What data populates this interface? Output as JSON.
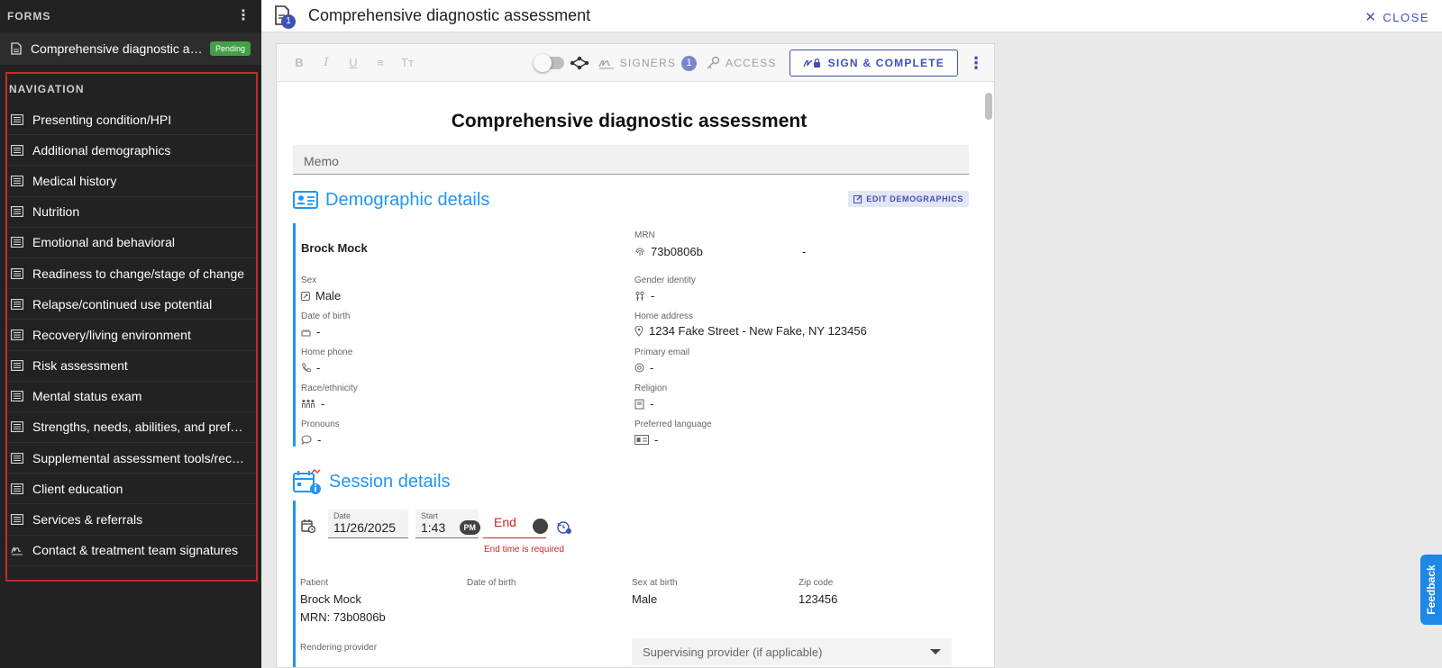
{
  "sidebar": {
    "forms_title": "FORMS",
    "form_item": {
      "label": "Comprehensive diagnostic assessment",
      "status": "Pending"
    },
    "nav_title": "NAVIGATION",
    "nav_items": [
      {
        "label": "Presenting condition/HPI",
        "icon": "list-icon"
      },
      {
        "label": "Additional demographics",
        "icon": "list-icon"
      },
      {
        "label": "Medical history",
        "icon": "list-icon"
      },
      {
        "label": "Nutrition",
        "icon": "list-icon"
      },
      {
        "label": "Emotional and behavioral",
        "icon": "list-icon"
      },
      {
        "label": "Readiness to change/stage of change",
        "icon": "list-icon"
      },
      {
        "label": "Relapse/continued use potential",
        "icon": "list-icon"
      },
      {
        "label": "Recovery/living environment",
        "icon": "list-icon"
      },
      {
        "label": "Risk assessment",
        "icon": "list-icon"
      },
      {
        "label": "Mental status exam",
        "icon": "list-icon"
      },
      {
        "label": "Strengths, needs, abilities, and preferences",
        "icon": "list-icon"
      },
      {
        "label": "Supplemental assessment tools/records",
        "icon": "list-icon"
      },
      {
        "label": "Client education",
        "icon": "list-icon"
      },
      {
        "label": "Services & referrals",
        "icon": "list-icon"
      },
      {
        "label": "Contact & treatment team signatures",
        "icon": "signature-icon"
      }
    ]
  },
  "topbar": {
    "title": "Comprehensive diagnostic assessment",
    "badge_count": "1",
    "close_label": "CLOSE"
  },
  "toolbar": {
    "bold": "B",
    "italic": "I",
    "underline": "U",
    "align": "≡",
    "clear_format": "Tт",
    "signers_label": "SIGNERS",
    "signers_count": "1",
    "access_label": "ACCESS",
    "sign_complete_label": "SIGN & COMPLETE"
  },
  "document": {
    "title": "Comprehensive diagnostic assessment",
    "memo_placeholder": "Memo",
    "demographics": {
      "section_title": "Demographic details",
      "edit_label": "EDIT DEMOGRAPHICS",
      "name": "Brock Mock",
      "mrn_label": "MRN",
      "mrn_value": "73b0806b",
      "mrn_extra": "-",
      "sex_label": "Sex",
      "sex_value": "Male",
      "gender_label": "Gender identity",
      "gender_value": "-",
      "dob_label": "Date of birth",
      "dob_value": "-",
      "address_label": "Home address",
      "address_value": "1234 Fake Street - New Fake, NY 123456",
      "phone_label": "Home phone",
      "phone_value": "-",
      "email_label": "Primary email",
      "email_value": "-",
      "race_label": "Race/ethnicity",
      "race_value": "-",
      "religion_label": "Religion",
      "religion_value": "-",
      "pronouns_label": "Pronouns",
      "pronouns_value": "-",
      "language_label": "Preferred language",
      "language_value": "-"
    },
    "session": {
      "section_title": "Session details",
      "date_label": "Date",
      "date_value": "11/26/2025",
      "start_label": "Start",
      "start_value": "1:43",
      "start_ampm": "PM",
      "end_placeholder": "End",
      "end_error": "End time is required",
      "patient_label": "Patient",
      "patient_name": "Brock Mock",
      "patient_mrn": "MRN: 73b0806b",
      "dob_label": "Date of birth",
      "sex_label": "Sex at birth",
      "sex_value": "Male",
      "zip_label": "Zip code",
      "zip_value": "123456",
      "rendering_label": "Rendering provider",
      "supervising_placeholder": "Supervising provider (if applicable)"
    }
  },
  "feedback_label": "Feedback",
  "colors": {
    "accent": "#3f51b5",
    "section": "#2196f3",
    "error": "#c62828",
    "pending": "#43a047",
    "sidebar": "#222222"
  }
}
